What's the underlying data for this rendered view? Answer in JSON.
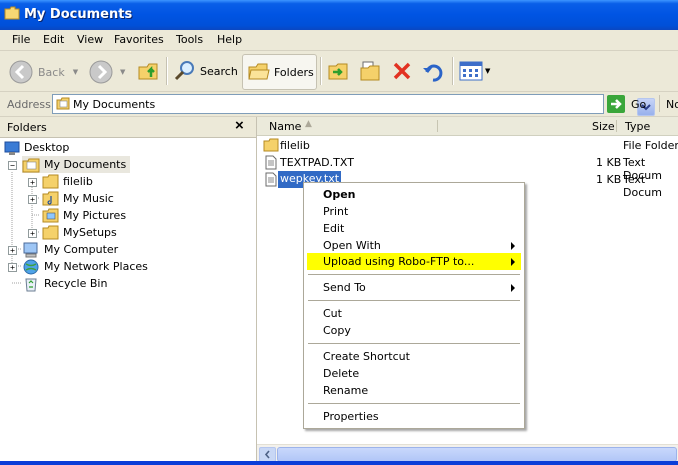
{
  "window": {
    "title": "My Documents"
  },
  "menubar": {
    "items": [
      "File",
      "Edit",
      "View",
      "Favorites",
      "Tools",
      "Help"
    ]
  },
  "toolbar": {
    "back": "Back",
    "search": "Search",
    "folders": "Folders"
  },
  "address": {
    "label": "Address",
    "value": "My Documents",
    "go": "Go",
    "links": "No"
  },
  "folders": {
    "title": "Folders",
    "close": "×",
    "tree": [
      "Desktop",
      "My Documents",
      "filelib",
      "My Music",
      "My Pictures",
      "MySetups",
      "My Computer",
      "My Network Places",
      "Recycle Bin"
    ]
  },
  "list": {
    "columns": {
      "name": "Name",
      "size": "Size",
      "type": "Type"
    },
    "rows": [
      {
        "name": "filelib",
        "size": "",
        "type": "File Folder"
      },
      {
        "name": "TEXTPAD.TXT",
        "size": "1 KB",
        "type": "Text Docum"
      },
      {
        "name": "wepkey.txt",
        "size": "1 KB",
        "type": "Text Docum"
      }
    ]
  },
  "context_menu": {
    "items": [
      "Open",
      "Print",
      "Edit",
      "Open With",
      "Upload using Robo-FTP to...",
      "Send To",
      "Cut",
      "Copy",
      "Create Shortcut",
      "Delete",
      "Rename",
      "Properties"
    ],
    "highlight_color": "#ffff00"
  },
  "colors": {
    "titlebar": "#0054e3",
    "selection": "#316ac5",
    "chrome": "#ece9d8"
  }
}
